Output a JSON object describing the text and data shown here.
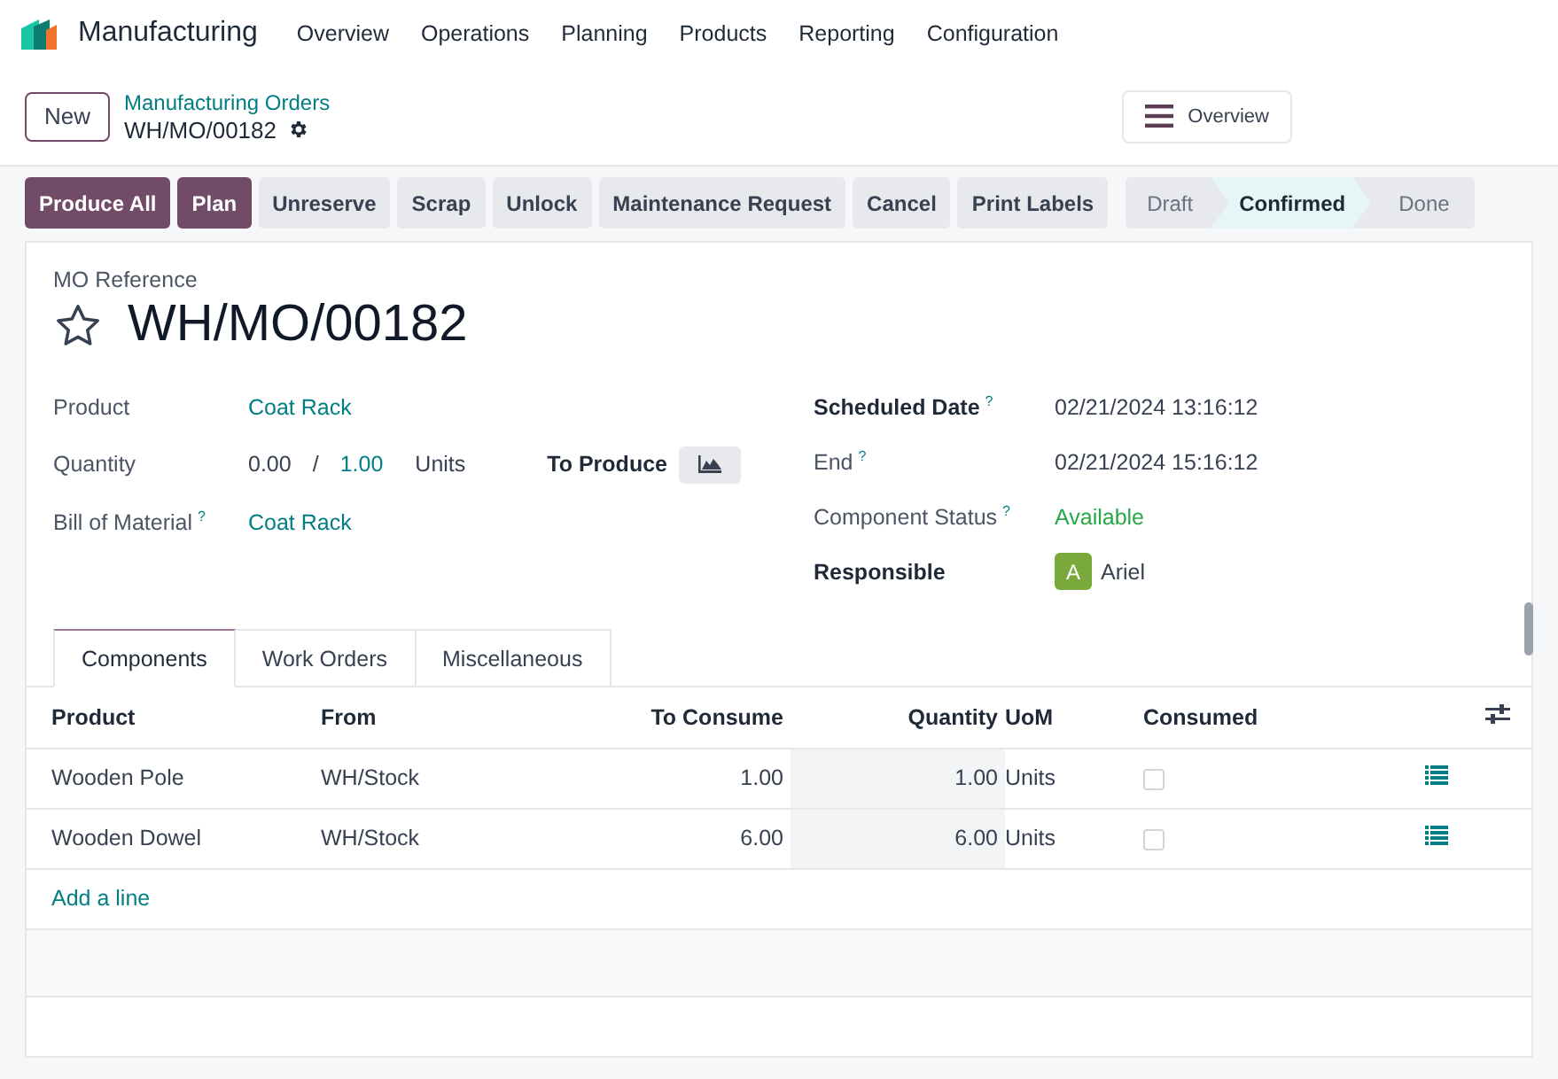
{
  "app": {
    "name": "Manufacturing",
    "menu": [
      "Overview",
      "Operations",
      "Planning",
      "Products",
      "Reporting",
      "Configuration"
    ]
  },
  "breadcrumb": {
    "new_button": "New",
    "parent": "Manufacturing Orders",
    "record": "WH/MO/00182"
  },
  "overview_button": "Overview",
  "actions": [
    {
      "label": "Produce All",
      "kind": "primary"
    },
    {
      "label": "Plan",
      "kind": "primary"
    },
    {
      "label": "Unreserve",
      "kind": "secondary"
    },
    {
      "label": "Scrap",
      "kind": "secondary"
    },
    {
      "label": "Unlock",
      "kind": "secondary"
    },
    {
      "label": "Maintenance Request",
      "kind": "secondary"
    },
    {
      "label": "Cancel",
      "kind": "secondary"
    },
    {
      "label": "Print Labels",
      "kind": "secondary"
    }
  ],
  "stages": [
    {
      "label": "Draft",
      "selected": false
    },
    {
      "label": "Confirmed",
      "selected": true
    },
    {
      "label": "Done",
      "selected": false
    }
  ],
  "form": {
    "reference_label": "MO Reference",
    "title": "WH/MO/00182",
    "starred": false,
    "left_fields": [
      {
        "label": "Product",
        "kind": "link",
        "value": "Coat Rack"
      },
      {
        "label": "Quantity",
        "kind": "quantity",
        "produced": "0.00",
        "separator": "/",
        "planned": "1.00",
        "uom": "Units",
        "extra_label": "To Produce"
      },
      {
        "label": "Bill of Material",
        "help": "?",
        "kind": "link",
        "value": "Coat Rack"
      }
    ],
    "right_fields": [
      {
        "label": "Scheduled Date",
        "help": "?",
        "bold": true,
        "kind": "text",
        "value": "02/21/2024 13:16:12"
      },
      {
        "label": "End",
        "help": "?",
        "bold": false,
        "kind": "text",
        "value": "02/21/2024 15:16:12"
      },
      {
        "label": "Component Status",
        "help": "?",
        "bold": false,
        "kind": "status",
        "value": "Available"
      },
      {
        "label": "Responsible",
        "bold": true,
        "kind": "user",
        "initial": "A",
        "value": "Ariel"
      }
    ]
  },
  "tabs": [
    {
      "label": "Components",
      "selected": true
    },
    {
      "label": "Work Orders",
      "selected": false
    },
    {
      "label": "Miscellaneous",
      "selected": false
    }
  ],
  "table": {
    "columns": [
      "Product",
      "From",
      "To Consume",
      "Quantity",
      "UoM",
      "Consumed"
    ],
    "rows": [
      {
        "product": "Wooden Pole",
        "from": "WH/Stock",
        "to_consume": "1.00",
        "quantity": "1.00",
        "uom": "Units",
        "consumed": false
      },
      {
        "product": "Wooden Dowel",
        "from": "WH/Stock",
        "to_consume": "6.00",
        "quantity": "6.00",
        "uom": "Units",
        "consumed": false
      }
    ],
    "add_line": "Add a line"
  }
}
